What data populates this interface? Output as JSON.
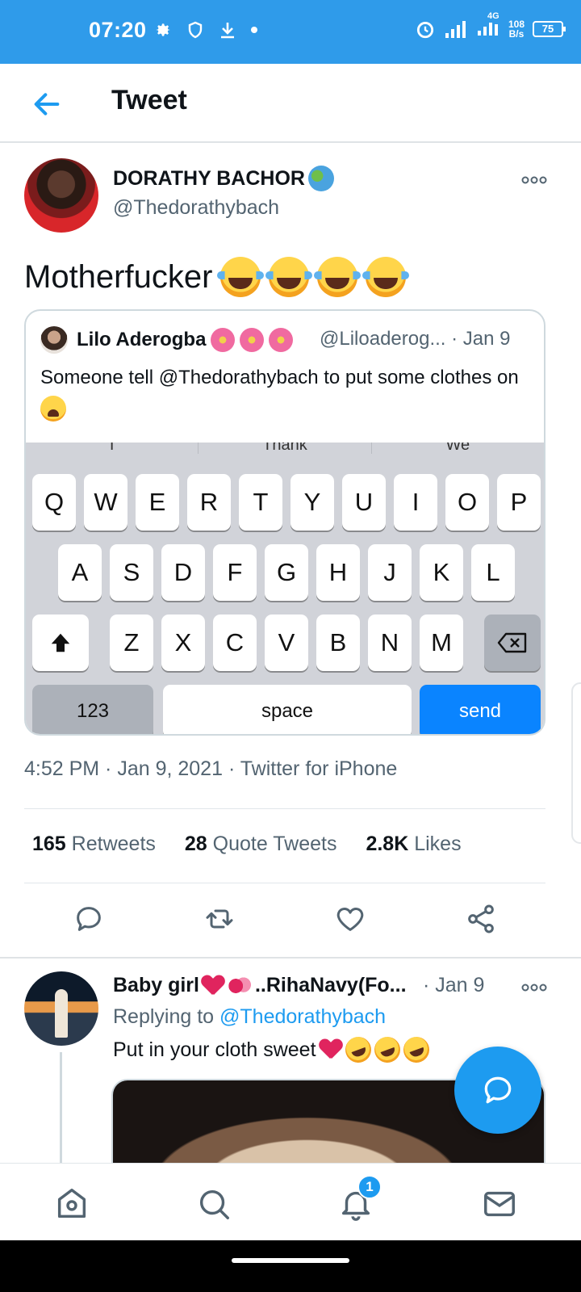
{
  "status_bar": {
    "time": "07:20",
    "network_label": "4G",
    "speed_value": "108",
    "speed_unit": "B/s",
    "battery": "75",
    "bg_color": "#2f9bea"
  },
  "header": {
    "title": "Tweet"
  },
  "tweet": {
    "author_name": "DORATHY BACHOR",
    "author_handle": "@Thedorathybach",
    "text": "Motherfucker",
    "timestamp": "4:52 PM · Jan 9, 2021",
    "source": "Twitter for iPhone",
    "stats": {
      "retweets_count": "165",
      "retweets_label": "Retweets",
      "quotes_count": "28",
      "quotes_label": "Quote Tweets",
      "likes_count": "2.8K",
      "likes_label": "Likes"
    }
  },
  "quoted_tweet": {
    "author_name": "Lilo Aderogba",
    "author_handle": "@Liloaderog... · Jan 9",
    "text": "Someone tell @Thedorathybach to put some clothes on",
    "keyboard": {
      "suggestions": [
        "I",
        "Thank",
        "We"
      ],
      "row1": [
        "Q",
        "W",
        "E",
        "R",
        "T",
        "Y",
        "U",
        "I",
        "O",
        "P"
      ],
      "row2": [
        "A",
        "S",
        "D",
        "F",
        "G",
        "H",
        "J",
        "K",
        "L"
      ],
      "row3": [
        "Z",
        "X",
        "C",
        "V",
        "B",
        "N",
        "M"
      ],
      "numbers_label": "123",
      "space_label": "space",
      "send_label": "send"
    }
  },
  "reply": {
    "author_name_prefix": "Baby girl",
    "author_name_suffix": "..RihaNavy(Fo...",
    "date": "· Jan 9",
    "replying_prefix": "Replying to",
    "replying_handle": "@Thedorathybach",
    "text": "Put in your cloth sweet"
  },
  "bottom_nav": {
    "notification_badge": "1"
  },
  "colors": {
    "accent": "#1d9bf0",
    "muted_text": "#536471",
    "send_key": "#0a84ff"
  }
}
